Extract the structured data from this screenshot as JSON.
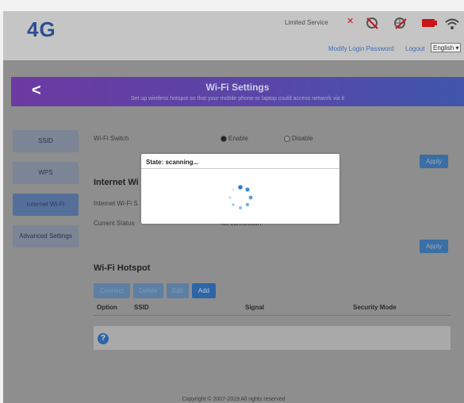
{
  "header": {
    "logo": "4G",
    "service_status": "Limited Service",
    "links": {
      "modify_password": "Modify Login Password",
      "logout": "Logout"
    },
    "language_selected": "English"
  },
  "banner": {
    "title": "Wi-Fi Settings",
    "subtitle": "Set up wireless hotspot so that your mobile phone or laptop could access network via it"
  },
  "sidebar": {
    "items": [
      {
        "label": "SSID"
      },
      {
        "label": "WPS"
      },
      {
        "label": "Internet Wi-Fi"
      },
      {
        "label": "Advanced Settings"
      }
    ]
  },
  "content": {
    "wifi_switch_label": "Wi-Fi Switch",
    "enable_label": "Enable",
    "disable_label": "Disable",
    "apply_label": "Apply",
    "internet_wifi_title": "Internet Wi",
    "internet_wifi_label": "Internet Wi-Fi S",
    "current_status_label": "Current Status",
    "current_status_value": "No connection",
    "hotspot_title": "Wi-Fi Hotspot",
    "buttons": {
      "connect": "Connect",
      "delete": "Delete",
      "edit": "Edit",
      "add": "Add"
    },
    "table_headers": [
      "Option",
      "SSID",
      "Signal",
      "Security Mode"
    ]
  },
  "modal": {
    "title": "State: scanning..."
  },
  "footer": {
    "copyright": "Copyright © 2007-2019 All rights reserved"
  },
  "colors": {
    "brand_blue": "#2a4f92",
    "accent_button": "#3a6ea4",
    "banner_purple": "#6b3aa2",
    "alert_red": "#c8141a"
  }
}
